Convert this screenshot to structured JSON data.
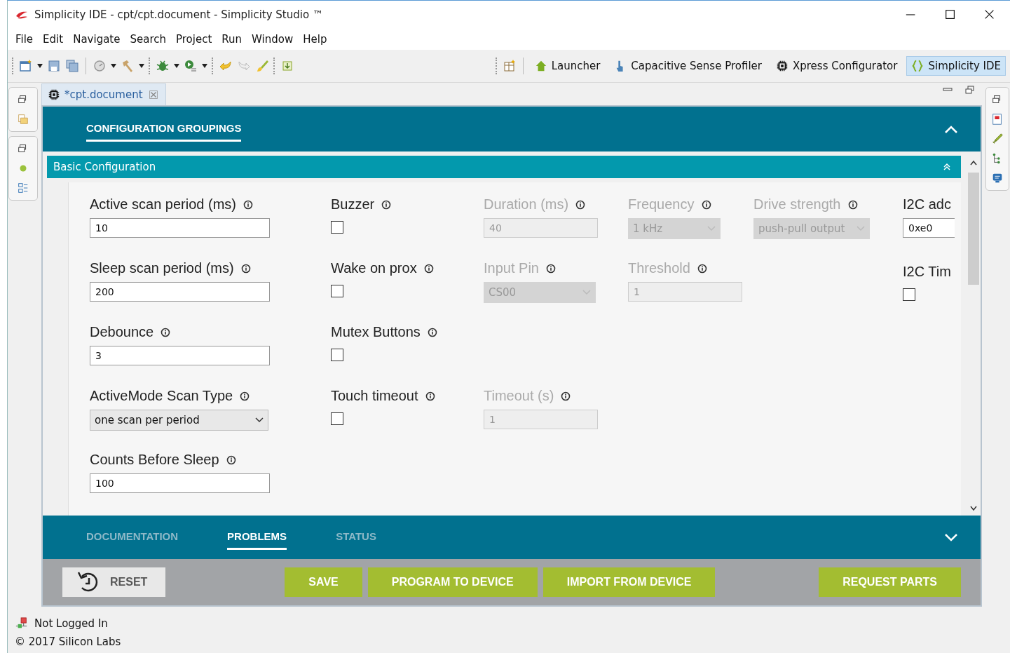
{
  "window": {
    "title": "Simplicity IDE - cpt/cpt.document - Simplicity Studio ™"
  },
  "menu": [
    "File",
    "Edit",
    "Navigate",
    "Search",
    "Project",
    "Run",
    "Window",
    "Help"
  ],
  "perspectives": [
    {
      "kind": "home",
      "label": "Launcher",
      "selected": false
    },
    {
      "kind": "touch",
      "label": "Capacitive Sense Profiler",
      "selected": false
    },
    {
      "kind": "chip",
      "label": "Xpress Configurator",
      "selected": false
    },
    {
      "kind": "braces",
      "label": "Simplicity IDE",
      "selected": true
    }
  ],
  "editor_tab": {
    "label": "*cpt.document"
  },
  "config_tabs": [
    {
      "label": "CONFIGURATION GROUPINGS",
      "selected": true
    }
  ],
  "section": {
    "title": "Basic Configuration",
    "expanded": true
  },
  "rows": [
    [
      {
        "kind": "text",
        "label": "Active scan period (ms)",
        "value": "10",
        "disabled": false
      },
      {
        "kind": "checkbox",
        "label": "Buzzer",
        "checked": false,
        "disabled": false
      },
      {
        "kind": "text",
        "label": "Duration (ms)",
        "value": "40",
        "disabled": true
      },
      {
        "kind": "select",
        "label": "Frequency",
        "value": "1 kHz",
        "disabled": true
      },
      {
        "kind": "select",
        "label": "Drive strength",
        "value": "push-pull output",
        "disabled": true
      }
    ],
    [
      {
        "kind": "text",
        "label": "Sleep scan period (ms)",
        "value": "200",
        "disabled": false
      },
      {
        "kind": "checkbox",
        "label": "Wake on prox",
        "checked": false,
        "disabled": false
      },
      {
        "kind": "select",
        "label": "Input Pin",
        "value": "CS00",
        "disabled": true
      },
      {
        "kind": "text",
        "label": "Threshold",
        "value": "1",
        "disabled": true
      }
    ],
    [
      {
        "kind": "text",
        "label": "Debounce",
        "value": "3",
        "disabled": false
      },
      {
        "kind": "checkbox",
        "label": "Mutex Buttons",
        "checked": false,
        "disabled": false
      }
    ],
    [
      {
        "kind": "select",
        "label": "ActiveMode Scan Type",
        "value": "one scan per period",
        "disabled": false
      },
      {
        "kind": "checkbox",
        "label": "Touch timeout",
        "checked": false,
        "disabled": false
      },
      {
        "kind": "text",
        "label": "Timeout (s)",
        "value": "1",
        "disabled": true
      }
    ],
    [
      {
        "kind": "text",
        "label": "Counts Before Sleep",
        "value": "100",
        "disabled": false
      }
    ]
  ],
  "side_column": [
    {
      "kind": "text",
      "label": "I2C adc",
      "value": "0xe0",
      "disabled": false
    },
    {
      "kind": "checkbox",
      "label": "I2C Tim",
      "checked": false,
      "disabled": false
    }
  ],
  "bottom_tabs": [
    {
      "label": "DOCUMENTATION",
      "selected": false
    },
    {
      "label": "PROBLEMS",
      "selected": true
    },
    {
      "label": "STATUS",
      "selected": false
    }
  ],
  "actions": [
    {
      "kind": "reset",
      "label": "RESET"
    },
    {
      "kind": "primary",
      "label": "SAVE"
    },
    {
      "kind": "primary",
      "label": "PROGRAM TO DEVICE"
    },
    {
      "kind": "primary",
      "label": "IMPORT FROM DEVICE"
    }
  ],
  "aside_actions": [
    {
      "kind": "primary",
      "label": "REQUEST PARTS"
    }
  ],
  "status_bar": [
    {
      "kind": "login",
      "label": "Not Logged In"
    },
    {
      "kind": "plain",
      "label": "© 2017 Silicon Labs"
    }
  ]
}
